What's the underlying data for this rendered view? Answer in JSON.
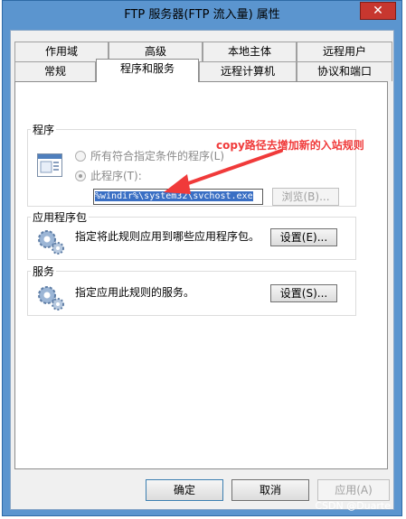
{
  "window": {
    "title": "FTP 服务器(FTP 流入量) 属性",
    "close_glyph": "✕"
  },
  "tabs": {
    "back_row": [
      "作用域",
      "高级",
      "本地主体",
      "远程用户"
    ],
    "front_row": [
      "常规",
      "程序和服务",
      "远程计算机",
      "协议和端口"
    ],
    "active": "程序和服务"
  },
  "programs": {
    "title": "程序",
    "option_all": "所有符合指定条件的程序(L)",
    "option_this": "此程序(T):",
    "path_value": "%windir%\\system32\\svchost.exe",
    "browse_label": "浏览(B)..."
  },
  "packages": {
    "title": "应用程序包",
    "description": "指定将此规则应用到哪些应用程序包。",
    "settings_label": "设置(E)..."
  },
  "services": {
    "title": "服务",
    "description": "指定应用此规则的服务。",
    "settings_label": "设置(S)..."
  },
  "footer": {
    "ok_label": "确定",
    "cancel_label": "取消",
    "apply_label": "应用(A)"
  },
  "annotation": {
    "text": "copy路径去增加新的入站规则",
    "color": "#f03a3a"
  },
  "watermark": "CSDN @Duarte",
  "icons": {
    "program": "program-window-icon",
    "gear": "gear-icon",
    "close": "close-icon"
  }
}
